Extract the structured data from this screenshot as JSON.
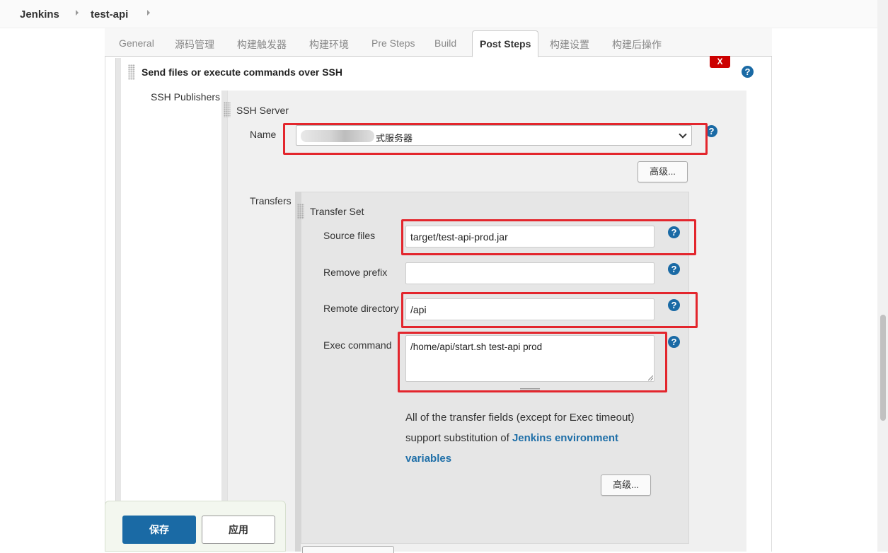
{
  "breadcrumb": {
    "home": "Jenkins",
    "job": "test-api"
  },
  "tabs": [
    "General",
    "源码管理",
    "构建触发器",
    "构建环境",
    "Pre Steps",
    "Build",
    "Post Steps",
    "构建设置",
    "构建后操作"
  ],
  "active_tab": "Post Steps",
  "section": {
    "title": "Send files or execute commands over SSH",
    "delete_label": "X",
    "publishers_label": "SSH Publishers",
    "server_label": "SSH Server",
    "name_label": "Name",
    "name_value_visible": "式服务器",
    "advanced_label": "高级..."
  },
  "transfers": {
    "label": "Transfers",
    "set_label": "Transfer Set",
    "source_files_label": "Source files",
    "source_files_value": "target/test-api-prod.jar",
    "remove_prefix_label": "Remove prefix",
    "remove_prefix_value": "",
    "remote_dir_label": "Remote directory",
    "remote_dir_value": "/api",
    "exec_label": "Exec command",
    "exec_value": "/home/api/start.sh test-api prod",
    "help_text_1": "All of the transfer fields (except for Exec timeout) support substitution of ",
    "help_link": "Jenkins environment variables",
    "advanced_label": "高级..."
  },
  "help_icon": "?",
  "footer": {
    "save_label": "保存",
    "apply_label": "应用"
  },
  "colors": {
    "accent": "#1a6aa5",
    "highlight": "#e3262d",
    "delete": "#cc0000"
  }
}
